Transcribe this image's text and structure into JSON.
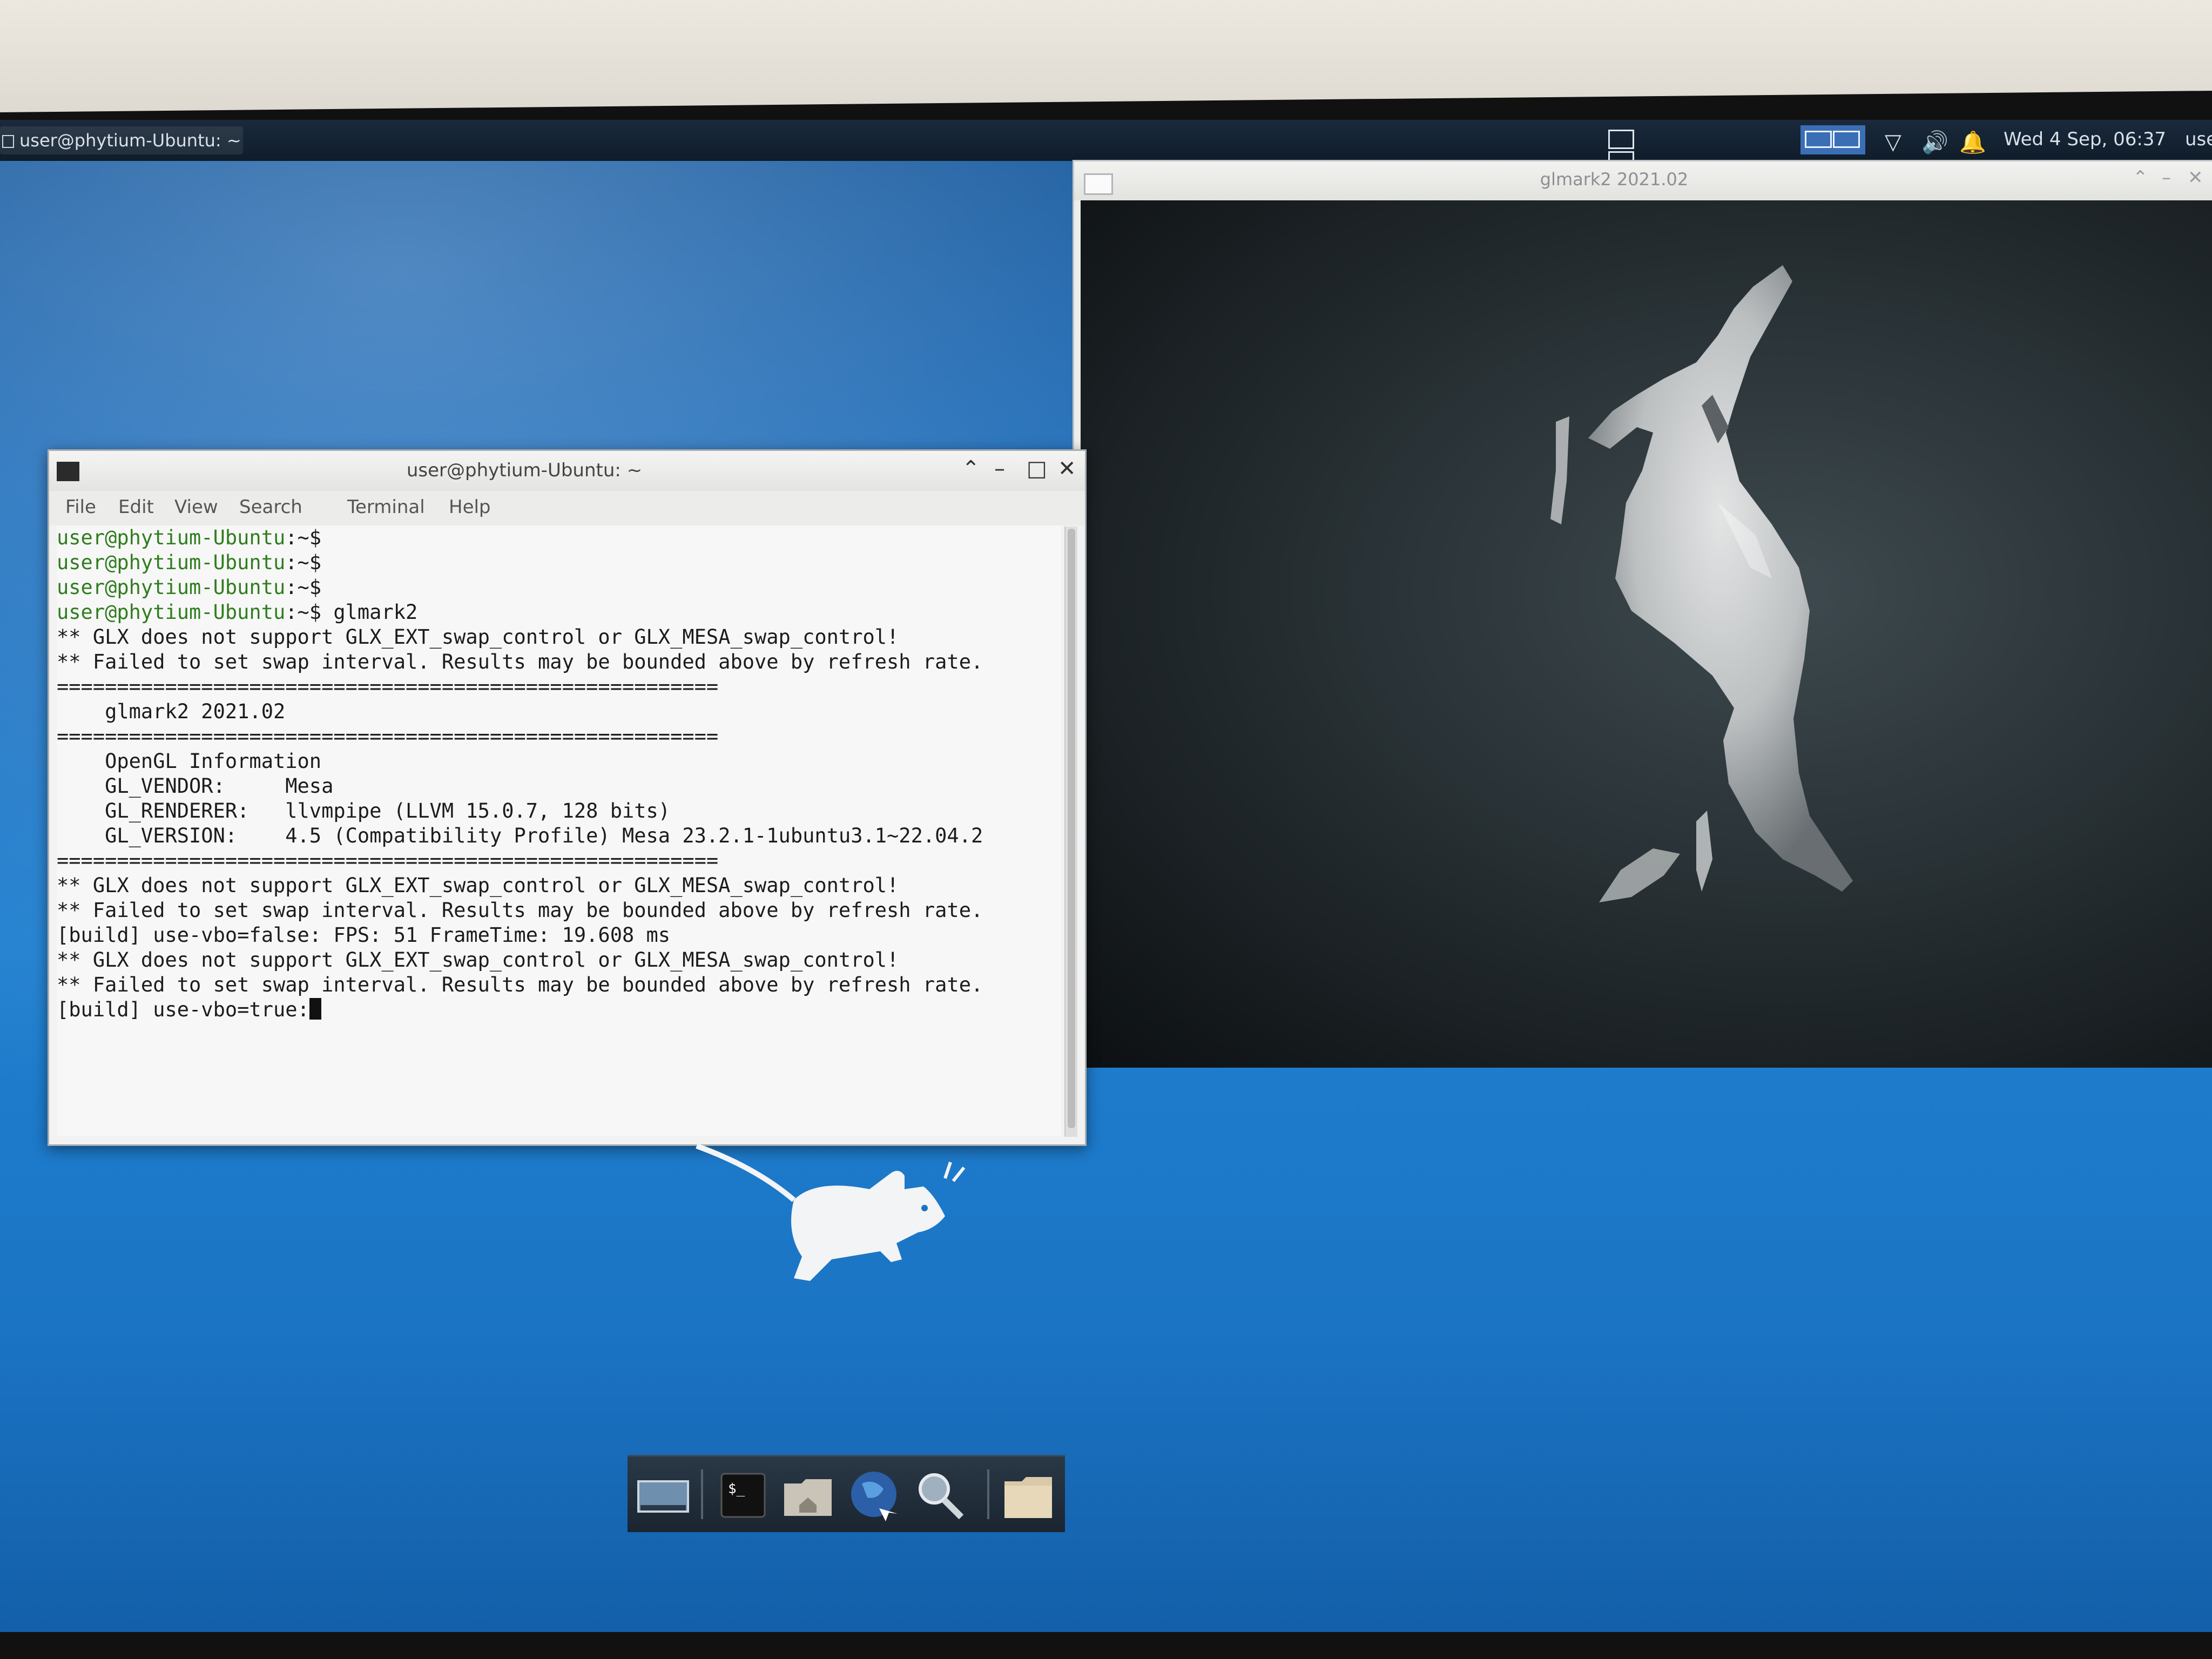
{
  "panel": {
    "taskbar_item": "user@phytium-Ubuntu: ~",
    "clock": "Wed  4 Sep, 06:37",
    "user": "use"
  },
  "glmark_window": {
    "title": "glmark2 2021.02"
  },
  "terminal": {
    "title": "user@phytium-Ubuntu: ~",
    "menu": [
      "File",
      "Edit",
      "View",
      "Search",
      "Terminal",
      "Help"
    ],
    "prompt": "user@phytium-Ubuntu",
    "prompt_suffix": ":~$",
    "command": " glmark2",
    "lines": [
      "** GLX does not support GLX_EXT_swap_control or GLX_MESA_swap_control!",
      "** Failed to set swap interval. Results may be bounded above by refresh rate.",
      "=======================================================",
      "    glmark2 2021.02",
      "=======================================================",
      "    OpenGL Information",
      "    GL_VENDOR:     Mesa",
      "    GL_RENDERER:   llvmpipe (LLVM 15.0.7, 128 bits)",
      "    GL_VERSION:    4.5 (Compatibility Profile) Mesa 23.2.1-1ubuntu3.1~22.04.2",
      "=======================================================",
      "** GLX does not support GLX_EXT_swap_control or GLX_MESA_swap_control!",
      "** Failed to set swap interval. Results may be bounded above by refresh rate.",
      "[build] use-vbo=false: FPS: 51 FrameTime: 19.608 ms",
      "** GLX does not support GLX_EXT_swap_control or GLX_MESA_swap_control!",
      "** Failed to set swap interval. Results may be bounded above by refresh rate.",
      "[build] use-vbo=true:"
    ]
  },
  "dock": {
    "items": [
      "show-desktop-icon",
      "terminal-icon",
      "home-folder-icon",
      "web-browser-icon",
      "search-icon",
      "folder-icon"
    ]
  },
  "colors": {
    "desktop": "#1b74c4",
    "prompt_green": "#2f7d1e",
    "panel": "#0f1c2a"
  }
}
